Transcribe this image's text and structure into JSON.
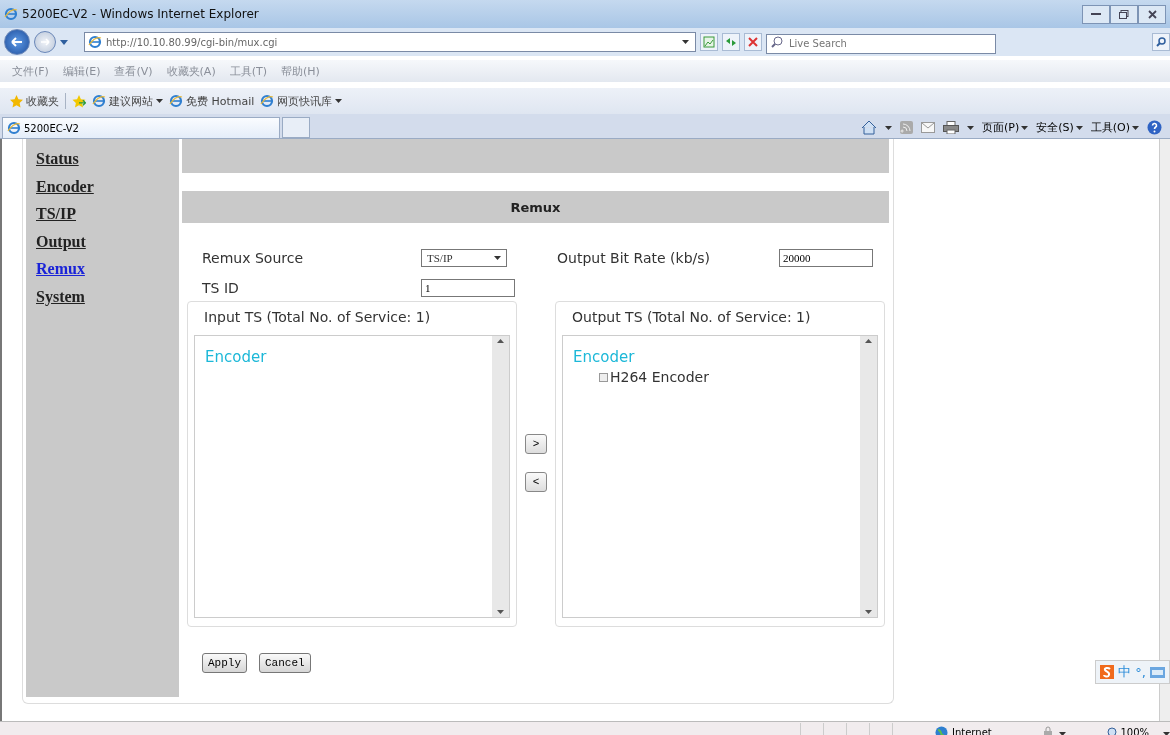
{
  "window": {
    "title": "5200EC-V2 - Windows Internet Explorer"
  },
  "address_bar": {
    "url": "http://10.10.80.99/cgi-bin/mux.cgi"
  },
  "search": {
    "placeholder": "Live Search"
  },
  "menu": [
    "文件(F)",
    "编辑(E)",
    "查看(V)",
    "收藏夹(A)",
    "工具(T)",
    "帮助(H)"
  ],
  "favorites_bar": {
    "label": "收藏夹",
    "links": [
      {
        "label": "建议网站",
        "dropdown": true
      },
      {
        "label": "免费 Hotmail",
        "dropdown": false
      },
      {
        "label": "网页快讯库",
        "dropdown": true
      }
    ]
  },
  "tabs": [
    {
      "label": "5200EC-V2",
      "selected": true
    }
  ],
  "command_bar": [
    "页面(P)",
    "安全(S)",
    "工具(O)"
  ],
  "sidebar": {
    "items": [
      {
        "label": "Status",
        "selected": false
      },
      {
        "label": "Encoder",
        "selected": false
      },
      {
        "label": "TS/IP",
        "selected": false
      },
      {
        "label": "Output",
        "selected": false
      },
      {
        "label": "Remux",
        "selected": true
      },
      {
        "label": "System",
        "selected": false
      }
    ]
  },
  "section_title": "Remux",
  "form": {
    "remux_source": {
      "label": "Remux Source",
      "value": "TS/IP"
    },
    "ts_id": {
      "label": "TS ID",
      "value": "1"
    },
    "output_bit_rate": {
      "label": "Output Bit Rate (kb/s)",
      "value": "20000"
    }
  },
  "input_ts": {
    "title": "Input TS (Total No. of Service: 1)",
    "groups": [
      {
        "label": "Encoder"
      }
    ]
  },
  "output_ts": {
    "title": "Output TS (Total No. of Service: 1)",
    "groups": [
      {
        "label": "Encoder",
        "children": [
          {
            "label": "H264 Encoder",
            "checked": false
          }
        ]
      }
    ]
  },
  "move_buttons": [
    ">",
    "<"
  ],
  "buttons": [
    "Apply",
    "Cancel"
  ],
  "ime_toolbar": [
    "中",
    "°,"
  ],
  "status_bar": {
    "zone": "Internet",
    "zoom": "100%"
  }
}
